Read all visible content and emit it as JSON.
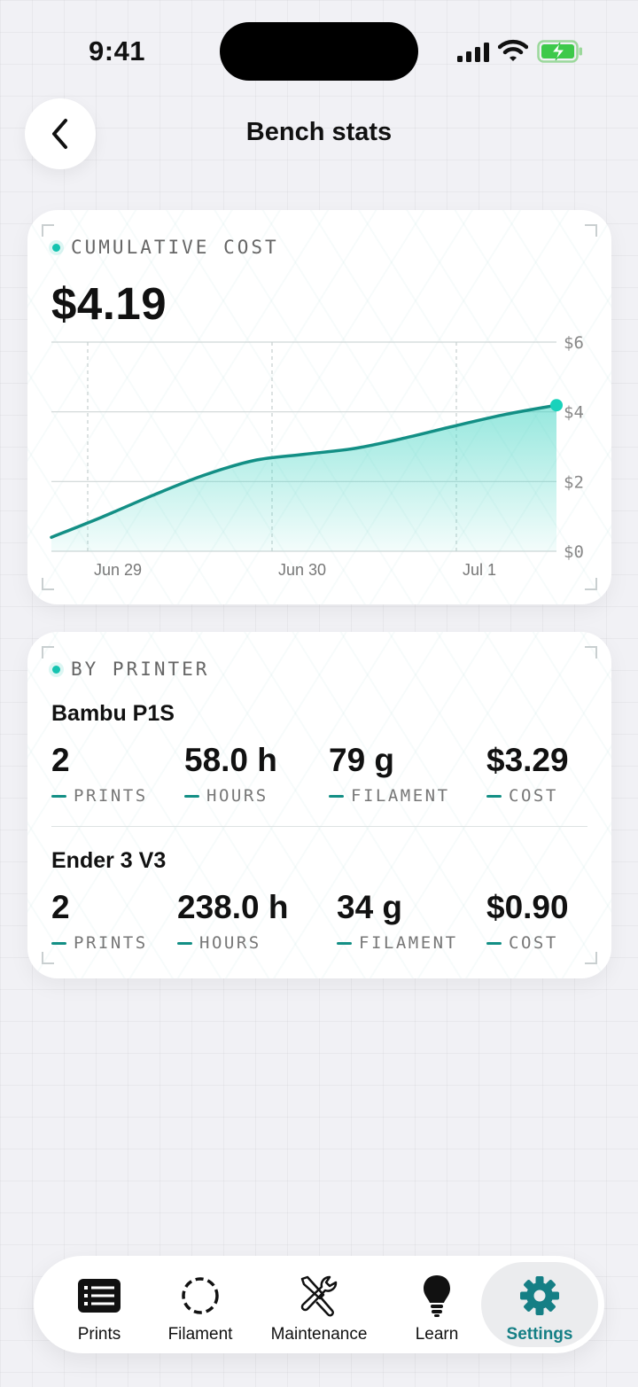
{
  "status": {
    "time": "9:41"
  },
  "header": {
    "title": "Bench stats"
  },
  "cumulative": {
    "label": "CUMULATIVE COST",
    "total": "$4.19"
  },
  "chart_data": {
    "type": "area",
    "title": "",
    "xlabel": "",
    "ylabel": "",
    "x_ticks": [
      "Jun 29",
      "Jun 30",
      "Jul 1"
    ],
    "y_ticks": [
      "$0",
      "$2",
      "$4",
      "$6"
    ],
    "ylim": [
      0,
      6
    ],
    "series": [
      {
        "values": [
          0.4,
          0.98,
          1.6,
          2.17,
          2.6,
          2.78,
          2.95,
          3.25,
          3.6,
          3.93,
          4.19
        ]
      }
    ],
    "grid": true,
    "accent_color": "#138f85",
    "fill_color": "#3fd4c2",
    "endpoint_color": "#19d2bb"
  },
  "by_printer": {
    "label": "BY PRINTER",
    "printers": [
      {
        "name": "Bambu P1S",
        "prints": "2",
        "prints_label": "PRINTS",
        "hours": "58.0 h",
        "hours_label": "HOURS",
        "filament": "79 g",
        "filament_label": "FILAMENT",
        "cost": "$3.29",
        "cost_label": "COST"
      },
      {
        "name": "Ender 3 V3",
        "prints": "2",
        "prints_label": "PRINTS",
        "hours": "238.0 h",
        "hours_label": "HOURS",
        "filament": "34 g",
        "filament_label": "FILAMENT",
        "cost": "$0.90",
        "cost_label": "COST"
      }
    ]
  },
  "tabs": [
    {
      "label": "Prints",
      "icon": "list-icon"
    },
    {
      "label": "Filament",
      "icon": "filament-spool-icon"
    },
    {
      "label": "Maintenance",
      "icon": "tools-icon"
    },
    {
      "label": "Learn",
      "icon": "lightbulb-icon"
    },
    {
      "label": "Settings",
      "icon": "gear-icon",
      "active": true
    }
  ],
  "colors": {
    "accent": "#157f85",
    "teal": "#15c3b0"
  }
}
